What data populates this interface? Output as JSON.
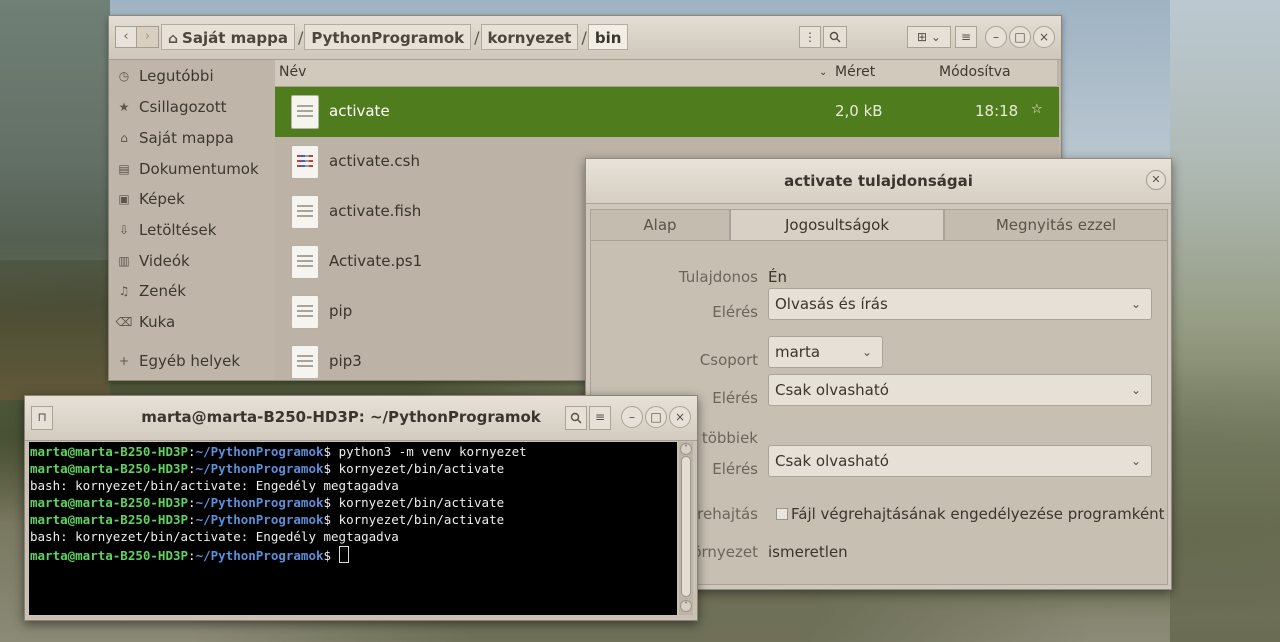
{
  "file_manager": {
    "breadcrumbs": [
      "Saját mappa",
      "PythonProgramok",
      "kornyezet",
      "bin"
    ],
    "toolbar_icons": [
      "more-icon",
      "search-icon",
      "grid-view-icon",
      "chevron-down-icon",
      "menu-icon",
      "minimize-icon",
      "maximize-icon",
      "close-icon"
    ],
    "sidebar": [
      {
        "icon": "clock-icon",
        "label": "Legutóbbi"
      },
      {
        "icon": "star-icon",
        "label": "Csillagozott"
      },
      {
        "icon": "home-icon",
        "label": "Saját mappa"
      },
      {
        "icon": "document-icon",
        "label": "Dokumentumok"
      },
      {
        "icon": "image-icon",
        "label": "Képek"
      },
      {
        "icon": "download-icon",
        "label": "Letöltések"
      },
      {
        "icon": "video-icon",
        "label": "Videók"
      },
      {
        "icon": "music-icon",
        "label": "Zenék"
      },
      {
        "icon": "trash-icon",
        "label": "Kuka"
      },
      {
        "icon": "plus-icon",
        "label": "Egyéb helyek"
      }
    ],
    "columns": {
      "name": "Név",
      "size": "Méret",
      "modified": "Módosítva"
    },
    "files": [
      {
        "name": "activate",
        "size": "2,0 kB",
        "modified": "18:18",
        "selected": true
      },
      {
        "name": "activate.csh",
        "size": "",
        "modified": "",
        "selected": false
      },
      {
        "name": "activate.fish",
        "size": "",
        "modified": "",
        "selected": false
      },
      {
        "name": "Activate.ps1",
        "size": "",
        "modified": "",
        "selected": false
      },
      {
        "name": "pip",
        "size": "",
        "modified": "",
        "selected": false
      },
      {
        "name": "pip3",
        "size": "",
        "modified": "",
        "selected": false
      }
    ]
  },
  "properties": {
    "title": "activate tulajdonságai",
    "tabs": [
      "Alap",
      "Jogosultságok",
      "Megnyitás ezzel"
    ],
    "active_tab": "Jogosultságok",
    "owner_label": "Tulajdonos",
    "owner_value": "Én",
    "owner_access_label": "Elérés",
    "owner_access_value": "Olvasás és írás",
    "group_label": "Csoport",
    "group_value": "marta",
    "group_access_label": "Elérés",
    "group_access_value": "Csak olvasható",
    "others_label": "többiek",
    "others_access_label": "Elérés",
    "others_access_value": "Csak olvasható",
    "execute_label": "rehajtás",
    "execute_checkbox_label": "Fájl végrehajtásának engedélyezése programként",
    "execute_checked": false,
    "context_label": "örnyezet",
    "context_value": "ismeretlen"
  },
  "terminal": {
    "title": "marta@marta-B250-HD3P: ~/PythonProgramok",
    "lines": [
      {
        "user": "marta@marta-B250-HD3P",
        "path": "~/PythonProgramok",
        "cmd": "$ python3 -m venv kornyezet"
      },
      {
        "user": "marta@marta-B250-HD3P",
        "path": "~/PythonProgramok",
        "cmd": "$ kornyezet/bin/activate"
      },
      {
        "text": "bash: kornyezet/bin/activate: Engedély megtagadva"
      },
      {
        "user": "marta@marta-B250-HD3P",
        "path": "~/PythonProgramok",
        "cmd": "$ kornyezet/bin/activate"
      },
      {
        "user": "marta@marta-B250-HD3P",
        "path": "~/PythonProgramok",
        "cmd": "$ kornyezet/bin/activate"
      },
      {
        "text": "bash: kornyezet/bin/activate: Engedély megtagadva"
      },
      {
        "user": "marta@marta-B250-HD3P",
        "path": "~/PythonProgramok",
        "cmd": "$ "
      }
    ]
  },
  "colors": {
    "selection": "#4f7d1d",
    "prompt_user": "#5fd35f",
    "prompt_path": "#5b8fd9"
  }
}
